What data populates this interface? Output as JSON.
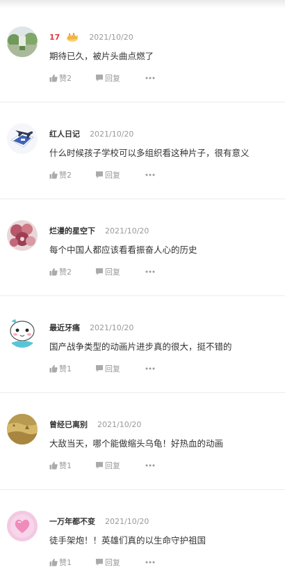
{
  "comments": [
    {
      "username": "17",
      "has_badge": true,
      "date": "2021/10/20",
      "text": "期待已久，被片头曲点燃了",
      "like_label": "赞2",
      "reply_label": "回复",
      "avatar_icon": "green-outdoor-avatar-icon"
    },
    {
      "username": "红人日记",
      "has_badge": false,
      "date": "2021/10/20",
      "text": "什么时候孩子学校可以多组织看这种片子，很有意义",
      "like_label": "赞2",
      "reply_label": "回复",
      "avatar_icon": "plane-ticket-avatar-icon"
    },
    {
      "username": "烂漫的星空下",
      "has_badge": false,
      "date": "2021/10/20",
      "text": "每个中国人都应该看看振奋人心的历史",
      "like_label": "赞2",
      "reply_label": "回复",
      "avatar_icon": "flowers-avatar-icon"
    },
    {
      "username": "最近牙痛",
      "has_badge": false,
      "date": "2021/10/20",
      "text": "国产战争类型的动画片进步真的很大，挺不错的",
      "like_label": "赞1",
      "reply_label": "回复",
      "avatar_icon": "cartoon-face-avatar-icon"
    },
    {
      "username": "曾经已离别",
      "has_badge": false,
      "date": "2021/10/20",
      "text": "大敌当天，哪个能做缩头乌龟！好热血的动画",
      "like_label": "赞1",
      "reply_label": "回复",
      "avatar_icon": "golden-field-avatar-icon"
    },
    {
      "username": "一万年都不变",
      "has_badge": false,
      "date": "2021/10/20",
      "text": "徒手架炮！！英雄们真的以生命守护祖国",
      "like_label": "赞1",
      "reply_label": "回复",
      "avatar_icon": "pink-heart-avatar-icon"
    }
  ],
  "colors": {
    "username": "#333333",
    "username_highlight": "#e03c3c",
    "meta_gray": "#999999",
    "divider": "#ececec"
  }
}
